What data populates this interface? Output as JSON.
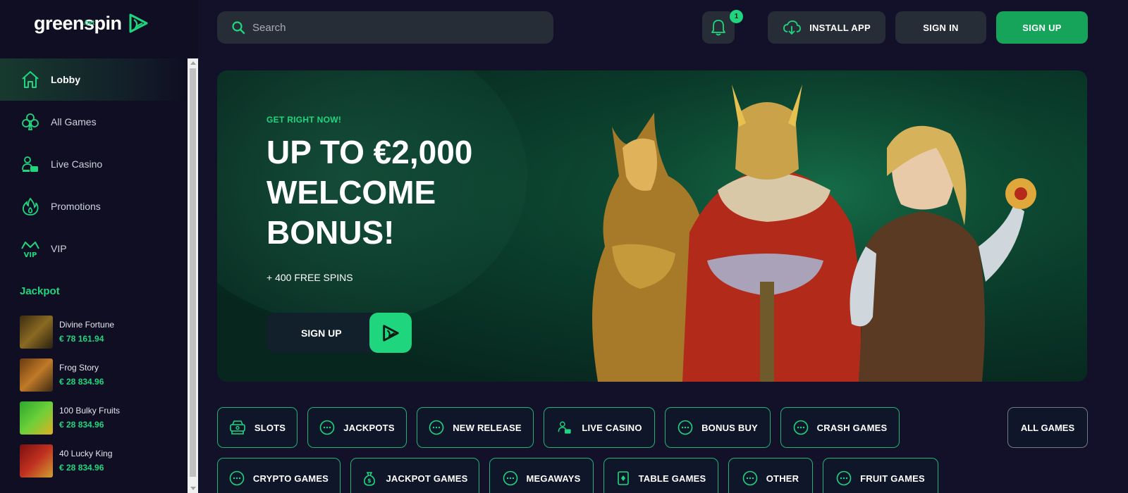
{
  "brand": {
    "name": "greenspin",
    "sub": ".bet"
  },
  "sidebar": {
    "items": [
      {
        "label": "Lobby",
        "icon": "home-icon"
      },
      {
        "label": "All Games",
        "icon": "club-icon"
      },
      {
        "label": "Live Casino",
        "icon": "live-dealer-icon"
      },
      {
        "label": "Promotions",
        "icon": "fire-icon"
      },
      {
        "label": "VIP",
        "icon": "crown-icon"
      }
    ],
    "active": "Lobby",
    "jackpot_title": "Jackpot",
    "jackpots": [
      {
        "name": "Divine Fortune",
        "amount": "€ 78 161.94"
      },
      {
        "name": "Frog Story",
        "amount": "€ 28 834.96"
      },
      {
        "name": "100 Bulky Fruits",
        "amount": "€ 28 834.96"
      },
      {
        "name": "40 Lucky King",
        "amount": "€ 28 834.96"
      }
    ]
  },
  "header": {
    "search_placeholder": "Search",
    "notifications_count": "1",
    "install_label": "INSTALL APP",
    "signin_label": "SIGN IN",
    "signup_label": "SIGN UP"
  },
  "banner": {
    "kicker": "GET RIGHT NOW!",
    "title": "UP TO €2,000 WELCOME BONUS!",
    "subtitle": "+ 400 FREE SPINS",
    "cta": "SIGN UP"
  },
  "categories": {
    "row1": [
      "SLOTS",
      "JACKPOTS",
      "NEW RELEASE",
      "LIVE CASINO",
      "BONUS BUY",
      "CRASH GAMES"
    ],
    "row2": [
      "CRYPTO GAMES",
      "JACKPOT GAMES",
      "MEGAWAYS",
      "TABLE GAMES",
      "OTHER",
      "FRUIT GAMES"
    ],
    "all_label": "ALL GAMES"
  },
  "colors": {
    "accent": "#1fd67e",
    "button_green": "#16a45a",
    "bg": "#13112a",
    "sidebar_bg": "#0f0e22",
    "banner_bg": "#0a3a2a"
  }
}
